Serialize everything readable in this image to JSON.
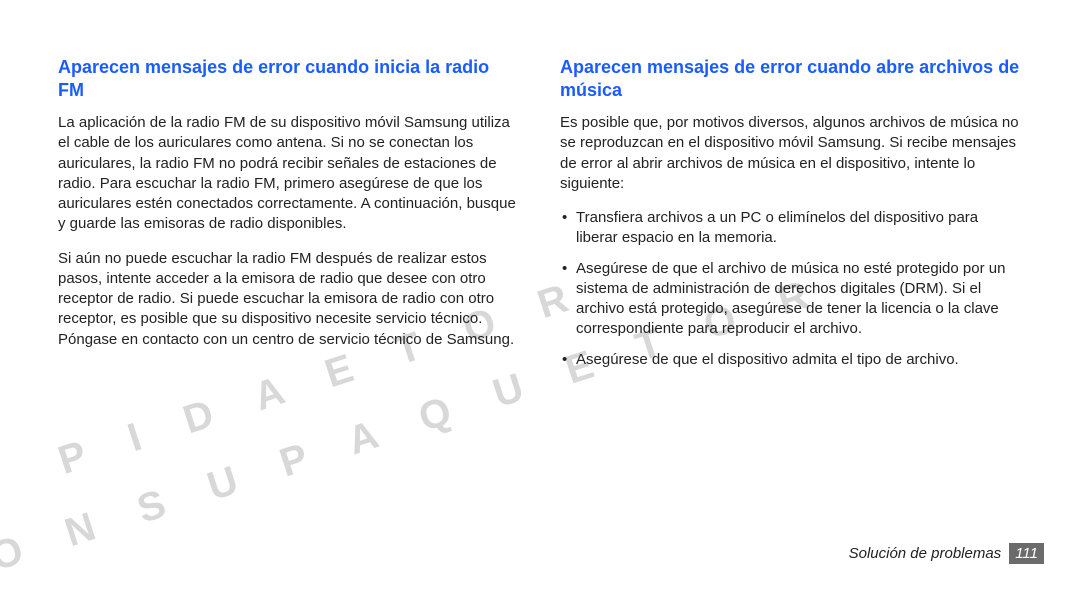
{
  "watermark": {
    "line1": "P I D A   E T O R",
    "line2": "C O N   S U   P A Q U E T O R"
  },
  "left": {
    "heading": "Aparecen mensajes de error cuando inicia la radio FM",
    "para1": "La aplicación de la radio FM de su dispositivo móvil Samsung utiliza el cable de los auriculares como antena. Si no se conectan los auriculares, la radio FM no podrá recibir señales de estaciones de radio. Para escuchar la radio FM, primero asegúrese de que los auriculares estén conectados correctamente. A continuación, busque y guarde las emisoras de radio disponibles.",
    "para2": "Si aún no puede escuchar la radio FM después de realizar estos pasos, intente acceder a la emisora de radio que desee con otro receptor de radio. Si puede escuchar la emisora de radio con otro receptor, es posible que su dispositivo necesite servicio técnico. Póngase en contacto con un centro de servicio técnico de Samsung."
  },
  "right": {
    "heading": "Aparecen mensajes de error cuando abre archivos de música",
    "para1": "Es posible que, por motivos diversos, algunos archivos de música no se reproduzcan en el dispositivo móvil Samsung. Si recibe mensajes de error al abrir archivos de música en el dispositivo, intente lo siguiente:",
    "bullets": [
      "Transfiera archivos a un PC o elimínelos del dispositivo para liberar espacio en la memoria.",
      "Asegúrese de que el archivo de música no esté protegido por un sistema de administración de derechos digitales (DRM). Si el archivo está protegido, asegúrese de tener la licencia o la clave correspondiente para reproducir el archivo.",
      "Asegúrese de que el dispositivo admita el tipo de archivo."
    ]
  },
  "footer": {
    "section": "Solución de problemas",
    "page": "111"
  }
}
